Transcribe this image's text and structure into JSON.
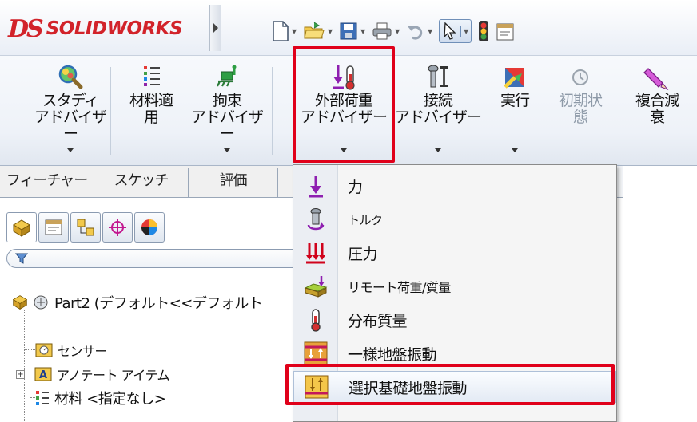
{
  "app": {
    "logo_ds": "DS",
    "logo_name": "SOLIDWORKS"
  },
  "quick_access": [
    {
      "name": "new-document",
      "icon": "new-document-icon"
    },
    {
      "name": "open",
      "icon": "folder-open-icon"
    },
    {
      "name": "save",
      "icon": "save-icon"
    },
    {
      "name": "print",
      "icon": "print-icon"
    },
    {
      "name": "undo",
      "icon": "undo-icon"
    },
    {
      "name": "select",
      "icon": "select-arrow-icon"
    },
    {
      "name": "rebuild",
      "icon": "traffic-light-icon"
    },
    {
      "name": "file-properties",
      "icon": "file-properties-icon"
    }
  ],
  "ribbon": {
    "study_advisor": "スタディ\nアドバイザー",
    "material": "材料適\n用",
    "fixtures_advisor": "拘束\nアドバイザー",
    "loads_advisor": "外部荷重\nアドバイザー",
    "connections_advisor": "接続\nアドバイザー",
    "run": "実行",
    "initial_conditions": "初期状\n態",
    "composite_damping": "複合減\n衰"
  },
  "tabs": [
    "フィーチャー",
    "スケッチ",
    "評価"
  ],
  "tree": {
    "part": "Part2  (デフォルト<<デフォルト",
    "sensors": "センサー",
    "annotations": "アノテート アイテム",
    "material": "材料 <指定なし>"
  },
  "menu": {
    "items": [
      {
        "label": "力",
        "icon": "force-arrow-icon"
      },
      {
        "label": "トルク",
        "icon": "torque-icon"
      },
      {
        "label": "圧力",
        "icon": "pressure-icon"
      },
      {
        "label": "リモート荷重/質量",
        "icon": "remote-load-icon"
      },
      {
        "label": "分布質量",
        "icon": "distributed-mass-icon"
      },
      {
        "label": "一様地盤振動",
        "icon": "uniform-base-excitation-icon"
      },
      {
        "label": "選択基礎地盤振動",
        "icon": "selected-base-excitation-icon",
        "selected": true
      }
    ]
  },
  "colors": {
    "brand_red": "#d2232a",
    "highlight": "#e0001a",
    "menu_hover": "#e3eaf4"
  }
}
